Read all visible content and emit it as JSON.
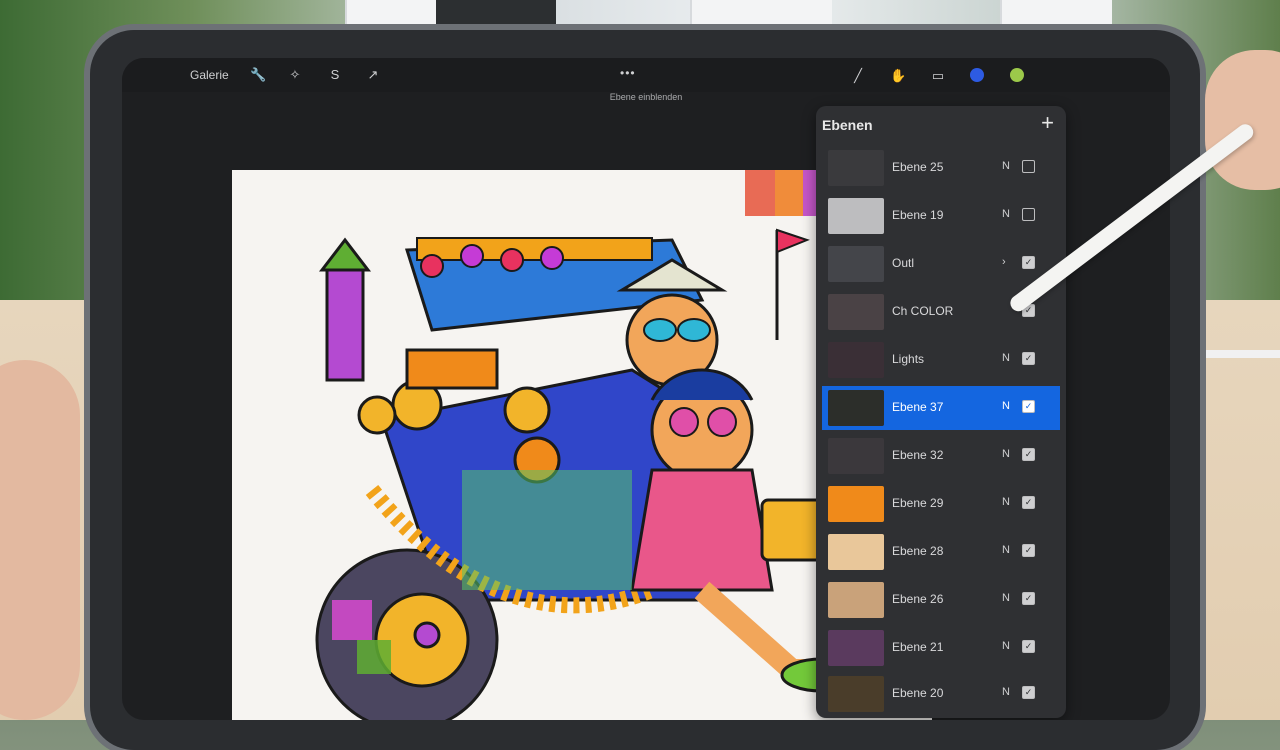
{
  "toolbar": {
    "gallery_label": "Galerie",
    "actions_icon": "wrench-icon",
    "adjustments_icon": "magic-wand-icon",
    "selection_icon": "selection-s-icon",
    "transform_icon": "cursor-arrow-icon",
    "more_label": "•••",
    "brush_icon": "brush-icon",
    "smudge_icon": "smudge-icon",
    "eraser_icon": "eraser-icon",
    "layers_icon": "layers-icon",
    "color": "#2d5be3",
    "color2": "#9cc94a"
  },
  "hint_text": "Ebene einblenden",
  "panel": {
    "title": "Ebenen",
    "add_label": "+",
    "layers": [
      {
        "name": "Ebene 25",
        "mode": "N",
        "visible": false,
        "selected": false
      },
      {
        "name": "Ebene 19",
        "mode": "N",
        "visible": false,
        "selected": false
      },
      {
        "name": "Outl",
        "mode": "›",
        "visible": true,
        "selected": false
      },
      {
        "name": "Ch COLOR",
        "mode": "",
        "visible": true,
        "selected": false
      },
      {
        "name": "Lights",
        "mode": "N",
        "visible": true,
        "selected": false
      },
      {
        "name": "Ebene 37",
        "mode": "N",
        "visible": true,
        "selected": true
      },
      {
        "name": "Ebene 32",
        "mode": "N",
        "visible": true,
        "selected": false
      },
      {
        "name": "Ebene 29",
        "mode": "N",
        "visible": true,
        "selected": false
      },
      {
        "name": "Ebene 28",
        "mode": "N",
        "visible": true,
        "selected": false
      },
      {
        "name": "Ebene 26",
        "mode": "N",
        "visible": true,
        "selected": false
      },
      {
        "name": "Ebene 21",
        "mode": "N",
        "visible": true,
        "selected": false
      },
      {
        "name": "Ebene 20",
        "mode": "N",
        "visible": true,
        "selected": false
      }
    ]
  },
  "undo_label": "↶"
}
